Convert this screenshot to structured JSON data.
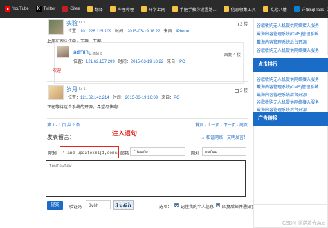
{
  "bookmarks": [
    {
      "label": "YouTube",
      "icon": "youtube-icon"
    },
    {
      "label": "Twitter",
      "icon": "x-icon"
    },
    {
      "label": "Gitee",
      "icon": "gitee-icon"
    },
    {
      "label": "翻译",
      "icon": "folder-icon"
    },
    {
      "label": "哔哩哔哩",
      "icon": "folder-icon"
    },
    {
      "label": "开学上网",
      "icon": "folder-icon"
    },
    {
      "label": "手把手教你设置路...",
      "icon": "folder-icon"
    },
    {
      "label": "信息收集工具",
      "icon": "folder-icon"
    },
    {
      "label": "乱七八糟",
      "icon": "folder-icon"
    },
    {
      "label": "详细sql-labs（1-...",
      "icon": "cc-icon"
    }
  ],
  "comments": [
    {
      "name": "实验",
      "level": "Lv 1",
      "ip_label": "位置：",
      "ip": "101.226.125.109",
      "time_label": "时间：",
      "time": "2015-03-19 18:22",
      "from_label": "来自：",
      "from": "iPhone",
      "floor": "3 楼",
      "text": "上周在跑队伍中，支持一下啊。"
    },
    {
      "name": "admin",
      "level": "认证站长",
      "ip_label": "位置：",
      "ip": "121.62.157.209",
      "time_label": "时间：",
      "time": "2015-03-19 18:22",
      "from_label": "来自：",
      "from": "PC",
      "floor": "回复 4 楼",
      "text": "欢迎！"
    },
    {
      "name": "岁月",
      "level": "Lv 1",
      "ip_label": "位置：",
      "ip": "121.62.142.214",
      "time_label": "时间：",
      "time": "2015-03-19 16:09",
      "from_label": "来自：",
      "from": "PC",
      "floor": "2 楼",
      "text": "正在等待这个系统的开源，希望尽快啊!"
    }
  ],
  "pager": {
    "info": "第 1 - 1 页 共 2 条",
    "links": "首页 · 上一页 · 下一页 · 尾页"
  },
  "form": {
    "title": "发表留言：",
    "hint": "→ 和谐网络，文明发言！",
    "name_label": "昵称",
    "name_value": "' and updatexml(1,concat(",
    "email_label": "邮箱",
    "email_value": "fdewfw",
    "url_label": "网址",
    "url_value": "ewfwe",
    "content_value": "fewfewfew",
    "submit_label": "提交",
    "captcha_label": "验证码",
    "captcha_value": "3v6h",
    "captcha_image_text": "3v6h",
    "options_label": "选项：",
    "option_remember": "记住我的个人信息",
    "option_notify": "回复后邮件通知我"
  },
  "annotation": {
    "text": "注入语句"
  },
  "sidebar": {
    "top_links": [
      "谷歌收购无人机提供网络接入服务",
      "戴海内容管理系统(CMS)管理系统",
      "戴海内容管理系统后台开源",
      "谷歌收购无人机提供网络接入服务"
    ],
    "hot_title": "点击排行",
    "hot_links": [
      "谷歌收购无人机提供网络接入服务",
      "戴海内容管理系统(CMS)管理系统",
      "戴海内容管理系统后台开源",
      "谷歌收购无人机提供网络接入服务",
      "戴海内容管理系统后台开源"
    ],
    "ads_title": "广告链接"
  },
  "watermark": "CSDN @逆着光Ace",
  "colors": {
    "accent": "#1a6cc7",
    "annotation": "#e3271d",
    "bookmark_bar": "#2b2b2b"
  }
}
